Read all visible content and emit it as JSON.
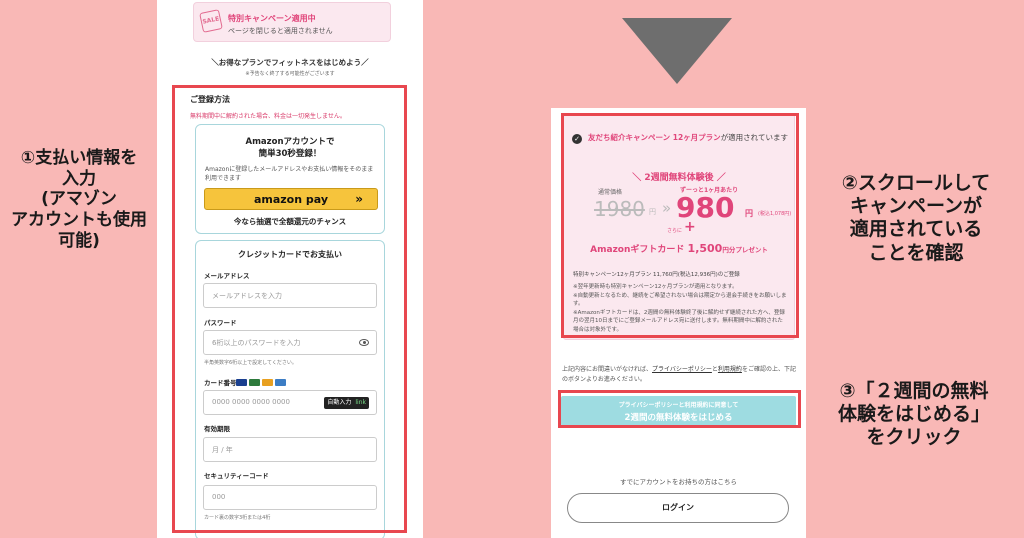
{
  "annotations": {
    "step1": [
      "①支払い情報を",
      "入力",
      "(アマゾン",
      "アカウントも使用",
      "可能)"
    ],
    "step2": [
      "②スクロールして",
      "キャンペーンが",
      "適用されている",
      "ことを確認"
    ],
    "step3": [
      "③「２週間の無料",
      "体験をはじめる」",
      "をクリック"
    ]
  },
  "left_phone": {
    "campaign_banner": {
      "icon_text": "SALE",
      "title": "特別キャンペーン適用中",
      "subtitle": "ページを閉じると適用されません"
    },
    "intro": "＼お得なプランでフィットネスをはじめよう／",
    "intro_note": "※予告なく終了する可能性がございます",
    "registration_title": "ご登録方法",
    "registration_warning": "無料期間中に解約された場合、料金は一切発生しません。",
    "amazon": {
      "title_line1": "Amazonアカウントで",
      "title_line2": "簡単30秒登録！",
      "description": "Amazonに登録したメールアドレスやお支払い情報をそのまま利用できます",
      "pay_label": "amazon pay",
      "pay_chevron": "»",
      "chance": "今なら抽選で全額還元のチャンス"
    },
    "credit_card": {
      "title": "クレジットカードでお支払い",
      "email_label": "メールアドレス",
      "email_placeholder": "メールアドレスを入力",
      "password_label": "パスワード",
      "password_placeholder": "6桁以上のパスワードを入力",
      "password_hint": "半角英数字6桁以上で設定してください。",
      "card_number_label": "カード番号",
      "card_number_placeholder": "0000 0000 0000 0000",
      "autofill_label": "自動入力",
      "autofill_link": "link",
      "expiry_label": "有効期限",
      "expiry_placeholder": "月 / 年",
      "cvc_label": "セキュリティーコード",
      "cvc_placeholder": "000",
      "cvc_hint": "カード裏の数字3桁または4桁"
    },
    "card_brand_icons": [
      "visa-icon",
      "jcb-icon",
      "mastercard-icon",
      "amex-icon"
    ],
    "card_brand_colors": [
      "#1a3f8f",
      "#2d7a3c",
      "#e8a020",
      "#3c7dc4"
    ]
  },
  "right_phone": {
    "referral_title_pink": "友だち紹介キャンペーン 12ヶ月プラン",
    "referral_title_rest": "が適用されています",
    "trial_label": "＼ 2週間無料体験後 ／",
    "regular_price_label": "通常価格",
    "old_price": "1980",
    "old_yen": "円",
    "price_arrow": "»",
    "new_price_label": "ずーっと1ヶ月あたり",
    "new_price": "980",
    "new_yen": "円",
    "tax_in": "(税込1,078円)",
    "plus_small": "さらに",
    "plus": "+",
    "gift_prefix": "Amazonギフトカード ",
    "gift_amount": "1,500",
    "gift_suffix": "円分プレゼント",
    "price_note": "特別キャンペーン12ヶ月プラン 11,760円(税込12,936円)のご登録",
    "notes": [
      "※翌年更新時も特別キャンペーン12ヶ月プランが適用となります。",
      "※自動更新となるため、継続をご希望されない場合は期定から退会手続きをお願いします。",
      "※Amazonギフトカードは、2週間の無料体験終了後に解約せず継続された方へ、登録月の翌月10日までにご登録メールアドレス宛に送付します。無料期間中に解約された場合は対象外です。"
    ],
    "privacy_prefix": "上記内容にお間違いがなければ、",
    "privacy_link": "プライバシーポリシー",
    "privacy_and": "と",
    "terms_link": "利用規約",
    "privacy_suffix": "をご確認の上、下記のボタンよりお進みください。",
    "cta_small": "プライバシーポリシーと利用規約に同意して",
    "cta_main": "2週間の無料体験をはじめる",
    "has_account": "すでにアカウントをお持ちの方はこちら",
    "login": "ログイン"
  },
  "colors": {
    "background": "#f9b8b6",
    "highlight_red": "#e8474f",
    "accent_pink": "#e0457a",
    "cta_teal": "#9edce1",
    "amazon_yellow": "#f6c43c"
  }
}
